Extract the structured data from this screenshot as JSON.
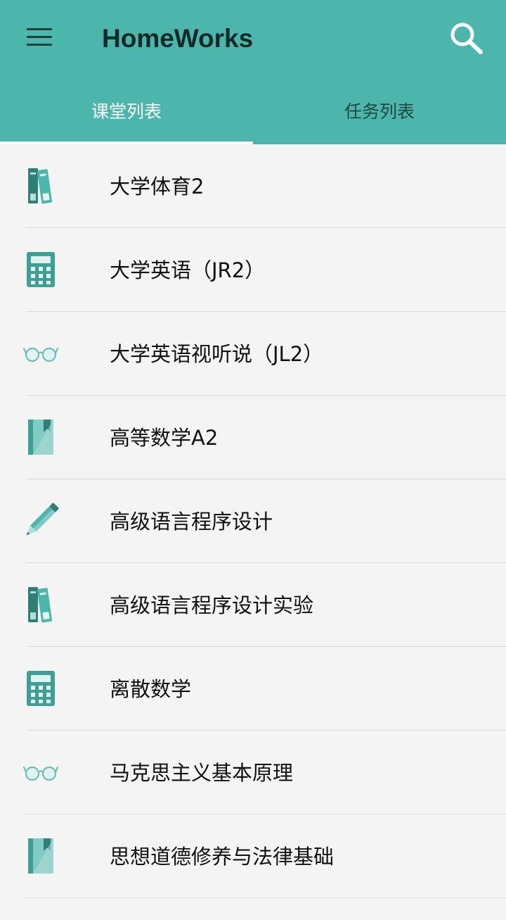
{
  "appbar": {
    "title": "HomeWorks",
    "menu_icon": "menu-icon",
    "search_icon": "search-icon",
    "color": "#4db6ac"
  },
  "tabs": [
    {
      "label": "课堂列表",
      "active": true
    },
    {
      "label": "任务列表",
      "active": false
    }
  ],
  "courses": [
    {
      "name": "大学体育2",
      "icon": "books-icon"
    },
    {
      "name": "大学英语（JR2）",
      "icon": "calculator-icon"
    },
    {
      "name": "大学英语视听说（JL2）",
      "icon": "glasses-icon"
    },
    {
      "name": "高等数学A2",
      "icon": "notebook-icon"
    },
    {
      "name": "高级语言程序设计",
      "icon": "pencil-icon"
    },
    {
      "name": "高级语言程序设计实验",
      "icon": "books-icon"
    },
    {
      "name": "离散数学",
      "icon": "calculator-icon"
    },
    {
      "name": "马克思主义基本原理",
      "icon": "glasses-icon"
    },
    {
      "name": "思想道德修养与法律基础",
      "icon": "notebook-icon"
    }
  ]
}
